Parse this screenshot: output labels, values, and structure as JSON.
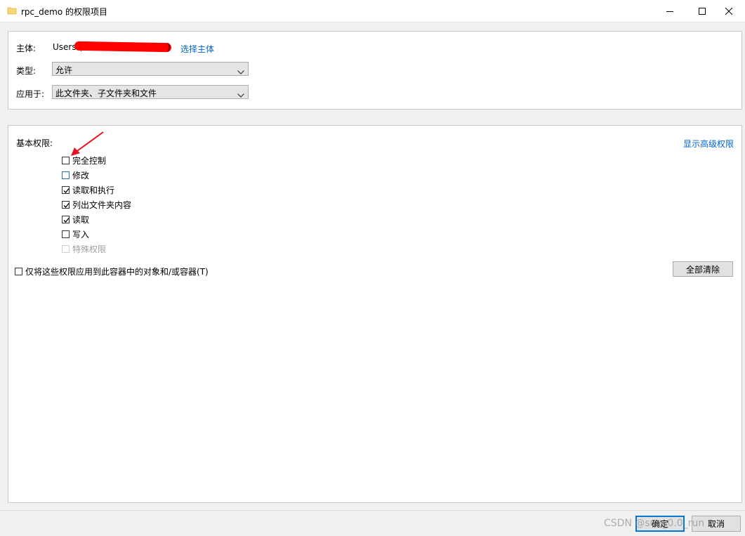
{
  "window": {
    "title": "rpc_demo 的权限项目",
    "icons": {
      "folder": "folder-icon",
      "minimize": "minimize-icon",
      "maximize": "maximize-icon",
      "close": "close-icon"
    }
  },
  "principal": {
    "label": "主体:",
    "value_prefix": "Users (",
    "value_suffix": ")",
    "select_link": "选择主体"
  },
  "type": {
    "label": "类型:",
    "selected": "允许"
  },
  "applies_to": {
    "label": "应用于:",
    "selected": "此文件夹、子文件夹和文件"
  },
  "permissions": {
    "heading": "基本权限:",
    "advanced_link": "显示高级权限",
    "items": [
      {
        "label": "完全控制",
        "checked": false,
        "state": "normal"
      },
      {
        "label": "修改",
        "checked": false,
        "state": "focused"
      },
      {
        "label": "读取和执行",
        "checked": true,
        "state": "normal"
      },
      {
        "label": "列出文件夹内容",
        "checked": true,
        "state": "normal"
      },
      {
        "label": "读取",
        "checked": true,
        "state": "normal"
      },
      {
        "label": "写入",
        "checked": false,
        "state": "normal"
      },
      {
        "label": "特殊权限",
        "checked": false,
        "state": "disabled"
      }
    ],
    "apply_only": {
      "label": "仅将这些权限应用到此容器中的对象和/或容器(T)",
      "checked": false
    },
    "clear_all": "全部清除"
  },
  "footer": {
    "ok": "确定",
    "cancel": "取消"
  },
  "watermark": "CSDN @sun_0.0_run",
  "colors": {
    "accent": "#0078d7",
    "link": "#0066cc",
    "annotation": "#e81123",
    "redaction": "#ff0000"
  }
}
